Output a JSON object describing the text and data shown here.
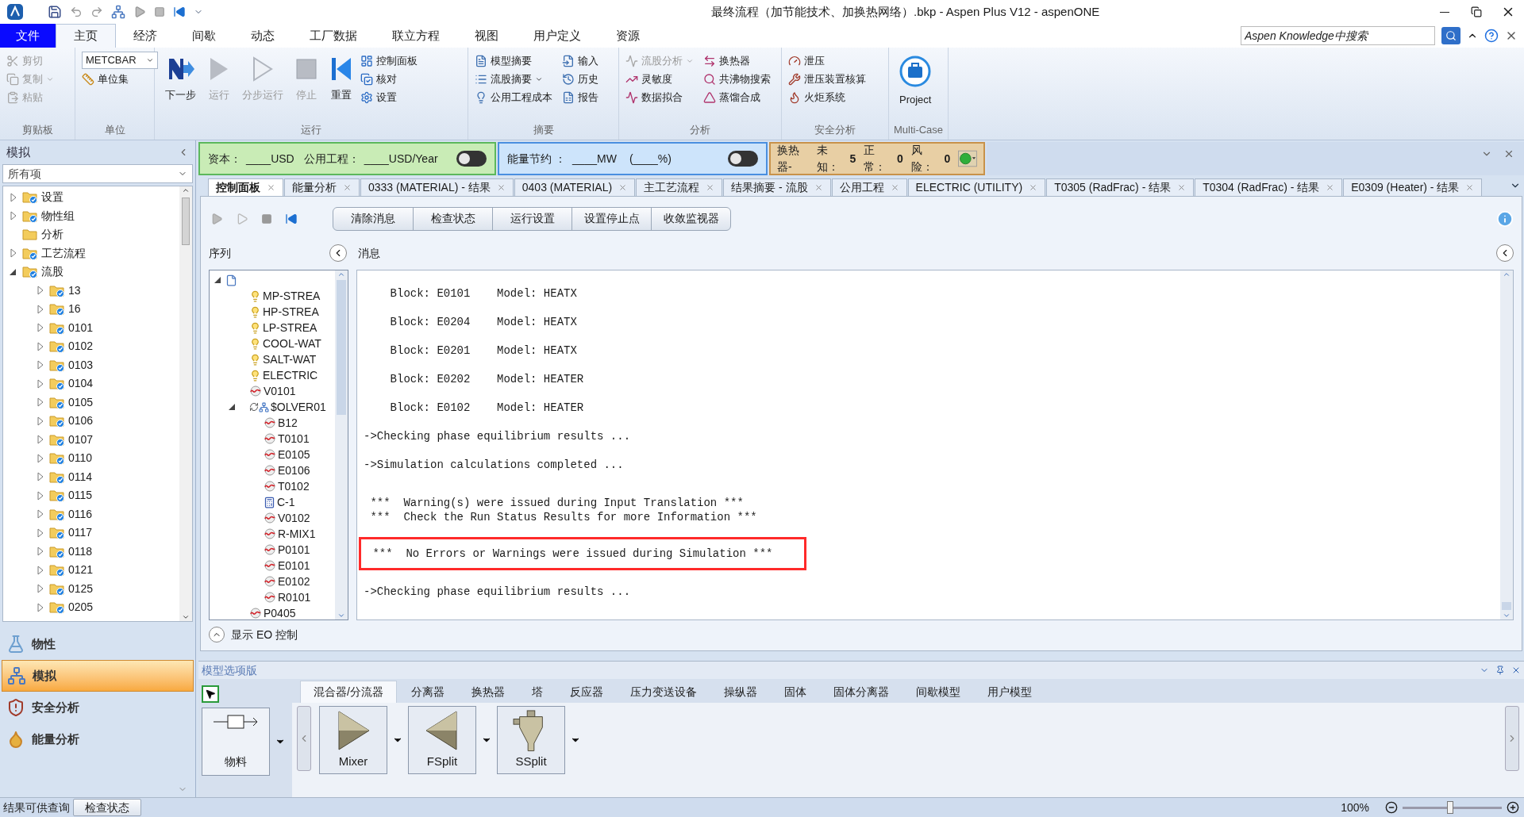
{
  "window": {
    "title": "最终流程（加节能技术、加换热网络）.bkp - Aspen Plus V12 - aspenONE"
  },
  "menu_tabs": [
    {
      "label": "文件",
      "kind": "file",
      "selected": false
    },
    {
      "label": "主页",
      "kind": "tab",
      "selected": true
    },
    {
      "label": "经济",
      "kind": "tab",
      "selected": false
    },
    {
      "label": "间歇",
      "kind": "tab",
      "selected": false
    },
    {
      "label": "动态",
      "kind": "tab",
      "selected": false
    },
    {
      "label": "工厂数据",
      "kind": "tab",
      "selected": false
    },
    {
      "label": "联立方程",
      "kind": "tab",
      "selected": false
    },
    {
      "label": "视图",
      "kind": "tab",
      "selected": false
    },
    {
      "label": "用户定义",
      "kind": "tab",
      "selected": false
    },
    {
      "label": "资源",
      "kind": "tab",
      "selected": false
    }
  ],
  "search": {
    "placeholder": "Aspen Knowledge中搜索"
  },
  "ribbon": [
    {
      "label": "剪贴板",
      "items": [
        {
          "label": "剪切",
          "kind": "small",
          "disabled": true,
          "caret": false
        },
        {
          "label": "复制",
          "kind": "small",
          "disabled": true,
          "caret": true
        },
        {
          "label": "粘贴",
          "kind": "small",
          "disabled": true,
          "caret": false
        }
      ]
    },
    {
      "label": "单位",
      "items": [
        {
          "value": "METCBAR",
          "kind": "dropdown",
          "disabled": false,
          "caret": true
        },
        {
          "label": "单位集",
          "kind": "small",
          "disabled": false,
          "caret": false
        }
      ]
    },
    {
      "label": "运行",
      "items": [
        {
          "label": "下一步",
          "kind": "large",
          "disabled": false,
          "caret": false
        },
        {
          "label": "运行",
          "kind": "large",
          "disabled": true,
          "caret": false
        },
        {
          "label": "分步运行",
          "kind": "large",
          "disabled": true,
          "caret": false
        },
        {
          "label": "停止",
          "kind": "large",
          "disabled": true,
          "caret": false
        },
        {
          "label": "重置",
          "kind": "large",
          "disabled": false,
          "caret": false
        },
        {
          "label": "控制面板",
          "kind": "small",
          "disabled": false,
          "caret": false
        },
        {
          "label": "核对",
          "kind": "small",
          "disabled": false,
          "caret": false
        },
        {
          "label": "设置",
          "kind": "small",
          "disabled": false,
          "caret": false
        }
      ]
    },
    {
      "label": "摘要",
      "items": [
        {
          "label": "模型摘要",
          "kind": "small",
          "disabled": false,
          "caret": false
        },
        {
          "label": "流股摘要",
          "kind": "small",
          "disabled": false,
          "caret": true
        },
        {
          "label": "公用工程成本",
          "kind": "small",
          "disabled": false,
          "caret": false
        },
        {
          "label": "输入",
          "kind": "small",
          "disabled": false,
          "caret": false
        },
        {
          "label": "历史",
          "kind": "small",
          "disabled": false,
          "caret": false
        },
        {
          "label": "报告",
          "kind": "small",
          "disabled": false,
          "caret": false
        }
      ]
    },
    {
      "label": "分析",
      "items": [
        {
          "label": "流股分析",
          "kind": "small",
          "disabled": true,
          "caret": true
        },
        {
          "label": "灵敏度",
          "kind": "small",
          "disabled": false,
          "caret": false
        },
        {
          "label": "数据拟合",
          "kind": "small",
          "disabled": false,
          "caret": false
        },
        {
          "label": "换热器",
          "kind": "small",
          "disabled": false,
          "caret": false
        },
        {
          "label": "共沸物搜索",
          "kind": "small",
          "disabled": false,
          "caret": false
        },
        {
          "label": "蒸馏合成",
          "kind": "small",
          "disabled": false,
          "caret": false
        }
      ]
    },
    {
      "label": "安全分析",
      "items": [
        {
          "label": "泄压",
          "kind": "small",
          "disabled": false,
          "caret": false
        },
        {
          "label": "泄压装置核算",
          "kind": "small",
          "disabled": false,
          "caret": false
        },
        {
          "label": "火炬系统",
          "kind": "small",
          "disabled": false,
          "caret": false
        }
      ]
    },
    {
      "label": "Multi-Case",
      "items": [
        {
          "label": "Project",
          "kind": "large",
          "disabled": false,
          "caret": false
        }
      ]
    }
  ],
  "left_panel": {
    "title": "模拟",
    "filter": "所有项",
    "tree": [
      {
        "label": "设置",
        "expanded": false
      },
      {
        "label": "物性组",
        "expanded": false
      },
      {
        "label": "分析"
      },
      {
        "label": "工艺流程",
        "expanded": false
      },
      {
        "label": "流股",
        "expanded": true,
        "children": [
          {
            "label": "13",
            "expanded": false
          },
          {
            "label": "16",
            "expanded": false
          },
          {
            "label": "0101",
            "expanded": false
          },
          {
            "label": "0102",
            "expanded": false
          },
          {
            "label": "0103",
            "expanded": false
          },
          {
            "label": "0104",
            "expanded": false
          },
          {
            "label": "0105",
            "expanded": false
          },
          {
            "label": "0106",
            "expanded": false
          },
          {
            "label": "0107",
            "expanded": false
          },
          {
            "label": "0110",
            "expanded": false
          },
          {
            "label": "0114",
            "expanded": false
          },
          {
            "label": "0115",
            "expanded": false
          },
          {
            "label": "0116",
            "expanded": false
          },
          {
            "label": "0117",
            "expanded": false
          },
          {
            "label": "0118",
            "expanded": false
          },
          {
            "label": "0121",
            "expanded": false
          },
          {
            "label": "0125",
            "expanded": false
          },
          {
            "label": "0205",
            "expanded": false
          }
        ]
      }
    ],
    "nav": [
      {
        "label": "物性",
        "selected": false
      },
      {
        "label": "模拟",
        "selected": true
      },
      {
        "label": "安全分析",
        "selected": false
      },
      {
        "label": "能量分析",
        "selected": false
      }
    ]
  },
  "cost_bar": {
    "capital_label": "资本：",
    "capital_value": "____USD",
    "utility_label": "公用工程：",
    "utility_value": "____USD/Year",
    "cost_toggle": {
      "on": false
    },
    "energy_label": "能量节约 ：",
    "energy_value": "____MW",
    "energy_percent": "(____%)",
    "energy_toggle": {
      "on": false
    },
    "exchanger_label": "换热器-",
    "exchanger_counts": [
      {
        "label": "未知：",
        "value": "5"
      },
      {
        "label": "正常：",
        "value": "0"
      },
      {
        "label": "风险：",
        "value": "0"
      }
    ]
  },
  "doc_tabs": [
    {
      "label": "控制面板",
      "selected": true
    },
    {
      "label": "能量分析",
      "selected": false
    },
    {
      "label": "0333 (MATERIAL) - 结果",
      "selected": false
    },
    {
      "label": "0403 (MATERIAL)",
      "selected": false
    },
    {
      "label": "主工艺流程",
      "selected": false
    },
    {
      "label": "结果摘要 - 流股",
      "selected": false
    },
    {
      "label": "公用工程",
      "selected": false
    },
    {
      "label": "ELECTRIC (UTILITY)",
      "selected": false
    },
    {
      "label": "T0305 (RadFrac) - 结果",
      "selected": false
    },
    {
      "label": "T0304 (RadFrac) - 结果",
      "selected": false
    },
    {
      "label": "E0309 (Heater) - 结果",
      "selected": false
    }
  ],
  "control_panel": {
    "buttons": [
      "清除消息",
      "检查状态",
      "运行设置",
      "设置停止点",
      "收敛监视器"
    ],
    "sequence_label": "序列",
    "messages_label": "消息",
    "sequence": [
      {
        "kind": "root",
        "expanded": true,
        "children": [
          {
            "label": "MP-STREA",
            "kind": "utility"
          },
          {
            "label": "HP-STREA",
            "kind": "utility"
          },
          {
            "label": "LP-STREA",
            "kind": "utility"
          },
          {
            "label": "COOL-WAT",
            "kind": "utility"
          },
          {
            "label": "SALT-WAT",
            "kind": "utility"
          },
          {
            "label": "ELECTRIC",
            "kind": "utility"
          },
          {
            "label": "V0101",
            "kind": "block"
          },
          {
            "label": "$OLVER01",
            "kind": "solver",
            "expanded": true,
            "children": [
              {
                "label": "B12",
                "kind": "block"
              },
              {
                "label": "T0101",
                "kind": "block"
              },
              {
                "label": "E0105",
                "kind": "block"
              },
              {
                "label": "E0106",
                "kind": "block"
              },
              {
                "label": "T0102",
                "kind": "block"
              },
              {
                "label": "C-1",
                "kind": "calculator"
              },
              {
                "label": "V0102",
                "kind": "block"
              },
              {
                "label": "R-MIX1",
                "kind": "block"
              },
              {
                "label": "P0101",
                "kind": "block"
              },
              {
                "label": "E0101",
                "kind": "block"
              },
              {
                "label": "E0102",
                "kind": "block"
              },
              {
                "label": "R0101",
                "kind": "block"
              }
            ]
          },
          {
            "label": "P0405",
            "kind": "block"
          }
        ]
      }
    ],
    "messages": [
      {
        "kind": "line",
        "highlighted": false,
        "lines": [
          "    Block: E0101    Model: HEATX"
        ]
      },
      {
        "kind": "line",
        "highlighted": false,
        "lines": [
          "    Block: E0204    Model: HEATX"
        ]
      },
      {
        "kind": "line",
        "highlighted": false,
        "lines": [
          "    Block: E0201    Model: HEATX"
        ]
      },
      {
        "kind": "line",
        "highlighted": false,
        "lines": [
          "    Block: E0202    Model: HEATER"
        ]
      },
      {
        "kind": "line",
        "highlighted": false,
        "lines": [
          "    Block: E0102    Model: HEATER"
        ]
      },
      {
        "kind": "line",
        "highlighted": false,
        "lines": [
          "->Checking phase equilibrium results ..."
        ]
      },
      {
        "kind": "line",
        "highlighted": false,
        "lines": [
          "->Simulation calculations completed ..."
        ]
      },
      {
        "kind": "summary",
        "highlighted": false,
        "lines": [
          " ***  Warning(s) were issued during Input Translation ***",
          " ***  Check the Run Status Results for more Information ***"
        ]
      },
      {
        "kind": "line",
        "highlighted": true,
        "lines": [
          " ***  No Errors or Warnings were issued during Simulation ***"
        ]
      },
      {
        "kind": "line",
        "highlighted": false,
        "lines": [
          "->Checking phase equilibrium results ..."
        ]
      }
    ],
    "eo_label": "显示 EO 控制"
  },
  "palette": {
    "title": "模型选项版",
    "tabs": [
      {
        "label": "混合器/分流器",
        "selected": true
      },
      {
        "label": "分离器",
        "selected": false
      },
      {
        "label": "换热器",
        "selected": false
      },
      {
        "label": "塔",
        "selected": false
      },
      {
        "label": "反应器",
        "selected": false
      },
      {
        "label": "压力变送设备",
        "selected": false
      },
      {
        "label": "操纵器",
        "selected": false
      },
      {
        "label": "固体",
        "selected": false
      },
      {
        "label": "固体分离器",
        "selected": false
      },
      {
        "label": "间歇模型",
        "selected": false
      },
      {
        "label": "用户模型",
        "selected": false
      }
    ],
    "stream": {
      "label": "物料"
    },
    "items": [
      {
        "label": "Mixer",
        "kind": "mixer"
      },
      {
        "label": "FSplit",
        "kind": "fsplit"
      },
      {
        "label": "SSplit",
        "kind": "ssplit"
      }
    ]
  },
  "status_bar": {
    "message": "结果可供查询",
    "button": "检查状态",
    "zoom": "100%",
    "zoom_slider": {
      "level": 0.48
    }
  }
}
